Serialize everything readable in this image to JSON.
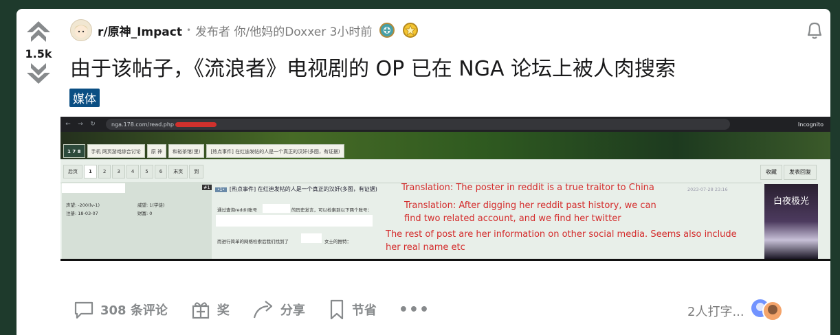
{
  "vote": {
    "count": "1.5k"
  },
  "post": {
    "subreddit": "r/原神_Impact",
    "byline": "发布者 你/他妈的Doxxer 3小时前",
    "title": "由于该帖子，《流浪者》电视剧的 OP 已在 NGA 论坛上被人肉搜索",
    "flair": "媒体"
  },
  "image": {
    "url": "nga.178.com/read.php",
    "incognito_label": "Incognito",
    "nav_items": [
      "1 7 8",
      "手机 网页游戏综合讨论",
      "原 神",
      "和裕茶馆(里)",
      "[热点事件] 在红迪发帖的人是一个真正的汉奸(多图，有证据)"
    ],
    "pager": [
      "后页",
      "1",
      "2",
      "3",
      "4",
      "5",
      "6",
      "末页",
      "到"
    ],
    "reply_labels": [
      "收藏",
      "发表回复"
    ],
    "thread_title": "[热点事件] 在红迪发帖的人是一个真正的汉奸(多图，有证据)",
    "thread_tag": "#1",
    "user_lines": [
      "声望: -200(lv-1)",
      "威望: 1(学徒)",
      "注册: 18-03-07",
      "财富: 0"
    ],
    "post_line1": "通过查询reddit账号",
    "post_line1b": "的历史发言，可以检索到以下两个账号：",
    "post_line2": "而进行简单的网络检索后我们找到了",
    "post_line2b": "女士的推特：",
    "timestamp": "2023-07-28 23:16",
    "side_text": "白夜极光",
    "translations": [
      "Translation: The poster in reddit is a true traitor to China",
      "Translation: After digging her reddit past history, we can",
      "find two related account, and we find her twitter",
      "The rest of post are her information on other social media. Seems also include",
      "her real name etc"
    ]
  },
  "actions": {
    "comments": "308 条评论",
    "award": "奖",
    "share": "分享",
    "save": "节省",
    "more": "•••"
  },
  "typing_indicator": "2人打字...",
  "colors": {
    "flair_bg": "#0a4e83",
    "translation_red": "#d42c2c",
    "page_bg": "#1e3a2c"
  }
}
